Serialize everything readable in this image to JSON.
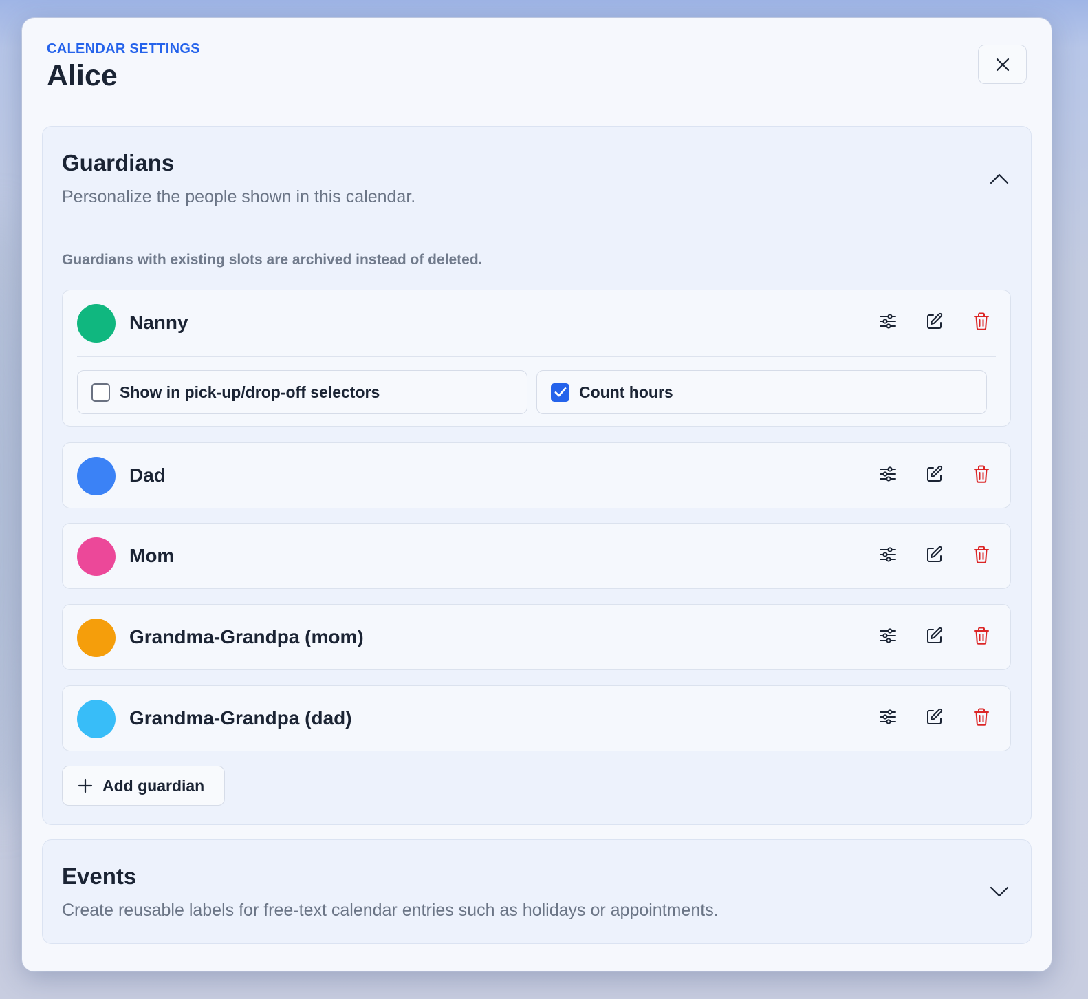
{
  "header": {
    "eyebrow": "CALENDAR SETTINGS",
    "title": "Alice"
  },
  "guardians_section": {
    "title": "Guardians",
    "description": "Personalize the people shown in this calendar.",
    "expanded": true,
    "note": "Guardians with existing slots are archived instead of deleted.",
    "guardians": [
      {
        "name": "Nanny",
        "color": "#10b77f"
      },
      {
        "name": "Dad",
        "color": "#3b82f6"
      },
      {
        "name": "Mom",
        "color": "#ec4899"
      },
      {
        "name": "Grandma-Grandpa (mom)",
        "color": "#f59e0b"
      },
      {
        "name": "Grandma-Grandpa (dad)",
        "color": "#38bdf8"
      }
    ],
    "expanded_options": {
      "show_in_selectors_label": "Show in pick-up/drop-off selectors",
      "show_in_selectors_checked": false,
      "count_hours_label": "Count hours",
      "count_hours_checked": true
    },
    "add_label": "Add guardian"
  },
  "events_section": {
    "title": "Events",
    "description": "Create reusable labels for free-text calendar entries such as holidays or appointments.",
    "expanded": false
  },
  "colors": {
    "accent": "#2563eb",
    "danger": "#dc2626",
    "text": "#1b2434"
  }
}
